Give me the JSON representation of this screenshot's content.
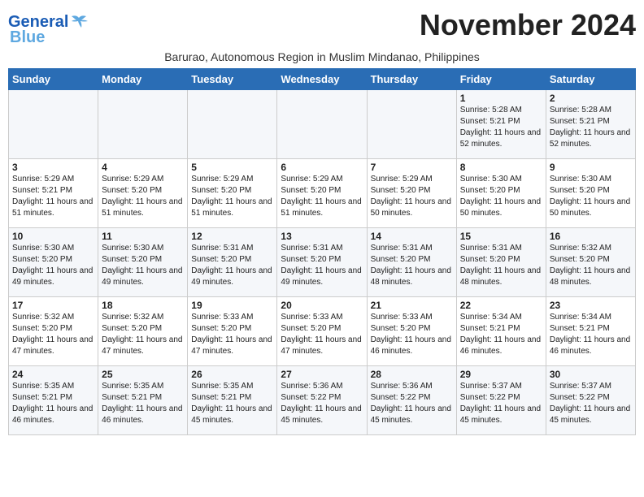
{
  "header": {
    "logo_line1": "General",
    "logo_line2": "Blue",
    "month_title": "November 2024",
    "subtitle": "Barurao, Autonomous Region in Muslim Mindanao, Philippines"
  },
  "weekdays": [
    "Sunday",
    "Monday",
    "Tuesday",
    "Wednesday",
    "Thursday",
    "Friday",
    "Saturday"
  ],
  "weeks": [
    [
      {
        "day": "",
        "info": ""
      },
      {
        "day": "",
        "info": ""
      },
      {
        "day": "",
        "info": ""
      },
      {
        "day": "",
        "info": ""
      },
      {
        "day": "",
        "info": ""
      },
      {
        "day": "1",
        "info": "Sunrise: 5:28 AM\nSunset: 5:21 PM\nDaylight: 11 hours and 52 minutes."
      },
      {
        "day": "2",
        "info": "Sunrise: 5:28 AM\nSunset: 5:21 PM\nDaylight: 11 hours and 52 minutes."
      }
    ],
    [
      {
        "day": "3",
        "info": "Sunrise: 5:29 AM\nSunset: 5:21 PM\nDaylight: 11 hours and 51 minutes."
      },
      {
        "day": "4",
        "info": "Sunrise: 5:29 AM\nSunset: 5:20 PM\nDaylight: 11 hours and 51 minutes."
      },
      {
        "day": "5",
        "info": "Sunrise: 5:29 AM\nSunset: 5:20 PM\nDaylight: 11 hours and 51 minutes."
      },
      {
        "day": "6",
        "info": "Sunrise: 5:29 AM\nSunset: 5:20 PM\nDaylight: 11 hours and 51 minutes."
      },
      {
        "day": "7",
        "info": "Sunrise: 5:29 AM\nSunset: 5:20 PM\nDaylight: 11 hours and 50 minutes."
      },
      {
        "day": "8",
        "info": "Sunrise: 5:30 AM\nSunset: 5:20 PM\nDaylight: 11 hours and 50 minutes."
      },
      {
        "day": "9",
        "info": "Sunrise: 5:30 AM\nSunset: 5:20 PM\nDaylight: 11 hours and 50 minutes."
      }
    ],
    [
      {
        "day": "10",
        "info": "Sunrise: 5:30 AM\nSunset: 5:20 PM\nDaylight: 11 hours and 49 minutes."
      },
      {
        "day": "11",
        "info": "Sunrise: 5:30 AM\nSunset: 5:20 PM\nDaylight: 11 hours and 49 minutes."
      },
      {
        "day": "12",
        "info": "Sunrise: 5:31 AM\nSunset: 5:20 PM\nDaylight: 11 hours and 49 minutes."
      },
      {
        "day": "13",
        "info": "Sunrise: 5:31 AM\nSunset: 5:20 PM\nDaylight: 11 hours and 49 minutes."
      },
      {
        "day": "14",
        "info": "Sunrise: 5:31 AM\nSunset: 5:20 PM\nDaylight: 11 hours and 48 minutes."
      },
      {
        "day": "15",
        "info": "Sunrise: 5:31 AM\nSunset: 5:20 PM\nDaylight: 11 hours and 48 minutes."
      },
      {
        "day": "16",
        "info": "Sunrise: 5:32 AM\nSunset: 5:20 PM\nDaylight: 11 hours and 48 minutes."
      }
    ],
    [
      {
        "day": "17",
        "info": "Sunrise: 5:32 AM\nSunset: 5:20 PM\nDaylight: 11 hours and 47 minutes."
      },
      {
        "day": "18",
        "info": "Sunrise: 5:32 AM\nSunset: 5:20 PM\nDaylight: 11 hours and 47 minutes."
      },
      {
        "day": "19",
        "info": "Sunrise: 5:33 AM\nSunset: 5:20 PM\nDaylight: 11 hours and 47 minutes."
      },
      {
        "day": "20",
        "info": "Sunrise: 5:33 AM\nSunset: 5:20 PM\nDaylight: 11 hours and 47 minutes."
      },
      {
        "day": "21",
        "info": "Sunrise: 5:33 AM\nSunset: 5:20 PM\nDaylight: 11 hours and 46 minutes."
      },
      {
        "day": "22",
        "info": "Sunrise: 5:34 AM\nSunset: 5:21 PM\nDaylight: 11 hours and 46 minutes."
      },
      {
        "day": "23",
        "info": "Sunrise: 5:34 AM\nSunset: 5:21 PM\nDaylight: 11 hours and 46 minutes."
      }
    ],
    [
      {
        "day": "24",
        "info": "Sunrise: 5:35 AM\nSunset: 5:21 PM\nDaylight: 11 hours and 46 minutes."
      },
      {
        "day": "25",
        "info": "Sunrise: 5:35 AM\nSunset: 5:21 PM\nDaylight: 11 hours and 46 minutes."
      },
      {
        "day": "26",
        "info": "Sunrise: 5:35 AM\nSunset: 5:21 PM\nDaylight: 11 hours and 45 minutes."
      },
      {
        "day": "27",
        "info": "Sunrise: 5:36 AM\nSunset: 5:22 PM\nDaylight: 11 hours and 45 minutes."
      },
      {
        "day": "28",
        "info": "Sunrise: 5:36 AM\nSunset: 5:22 PM\nDaylight: 11 hours and 45 minutes."
      },
      {
        "day": "29",
        "info": "Sunrise: 5:37 AM\nSunset: 5:22 PM\nDaylight: 11 hours and 45 minutes."
      },
      {
        "day": "30",
        "info": "Sunrise: 5:37 AM\nSunset: 5:22 PM\nDaylight: 11 hours and 45 minutes."
      }
    ]
  ]
}
